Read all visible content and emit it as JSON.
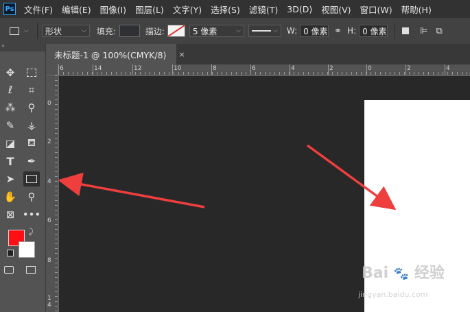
{
  "menubar": {
    "logo": "Ps",
    "items": [
      "文件(F)",
      "编辑(E)",
      "图像(I)",
      "图层(L)",
      "文字(Y)",
      "选择(S)",
      "滤镜(T)",
      "3D(D)",
      "视图(V)",
      "窗口(W)",
      "帮助(H)"
    ]
  },
  "options": {
    "mode_value": "形状",
    "fill_label": "填充:",
    "stroke_label": "描边:",
    "stroke_width": "5 像素",
    "w_label": "W:",
    "w_value": "0 像素",
    "h_label": "H:",
    "h_value": "0 像素",
    "fill_color": "#2f3033"
  },
  "document": {
    "tab_title": "未标题-1 @ 100%(CMYK/8)",
    "close_glyph": "×"
  },
  "ruler": {
    "top_labels": [
      "6",
      "14",
      "12",
      "10",
      "8",
      "6",
      "4",
      "2",
      "0",
      "2",
      "4"
    ],
    "left_labels": [
      "0",
      "2",
      "4",
      "6",
      "8",
      "1",
      "4"
    ]
  },
  "colors": {
    "foreground": "#ff0e14",
    "background": "#ffffff",
    "arrow": "#ef3e3e"
  },
  "watermark": {
    "brand": "Bai",
    "brand2": "经验",
    "url": "jingyan.baidu.com"
  }
}
